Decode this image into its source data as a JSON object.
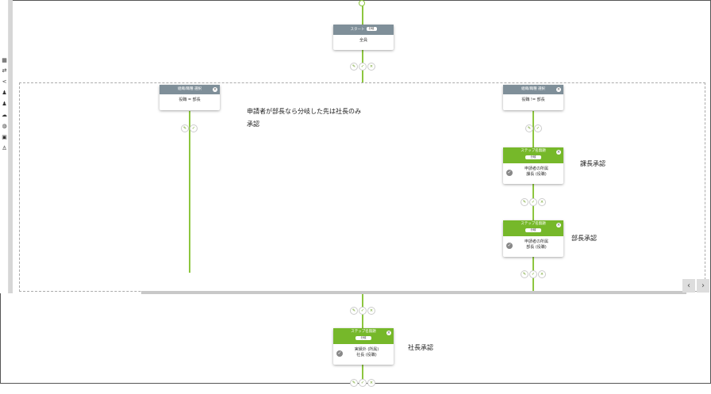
{
  "nodes": {
    "start": {
      "title": "スタート",
      "badge": "分岐",
      "body": "全員"
    },
    "branch_left": {
      "title": "組織/職種 選択",
      "body": "役職 = 部長"
    },
    "branch_right": {
      "title": "組織/職種 選択",
      "body": "役職 != 部長"
    },
    "step_kacho": {
      "title": "ステップ名無題",
      "badge": "分岐",
      "line1": "申請者の所属",
      "line2": "課長 (役職)"
    },
    "step_bucho": {
      "title": "ステップ名無題",
      "badge": "分岐",
      "line1": "申請者の所属",
      "line2": "部長 (役職)"
    },
    "step_shacho": {
      "title": "ステップ名無題",
      "badge": "分岐",
      "line1": "実績外 (所属)",
      "line2": "社長 (役職)"
    }
  },
  "notes": {
    "branch_note_line1": "申請者が部長なら分岐した先は社長のみ",
    "branch_note_line2": "承認",
    "kacho": "課長承認",
    "bucho": "部長承認",
    "shacho": "社長承認"
  },
  "icons": {
    "edit": "✎",
    "check": "✓",
    "close": "×",
    "prev": "‹",
    "next": "›",
    "checkmark": "✓"
  },
  "colors": {
    "flow_line": "#8dc63f",
    "step_header": "#76b82a",
    "branch_header": "#7f8f99"
  }
}
